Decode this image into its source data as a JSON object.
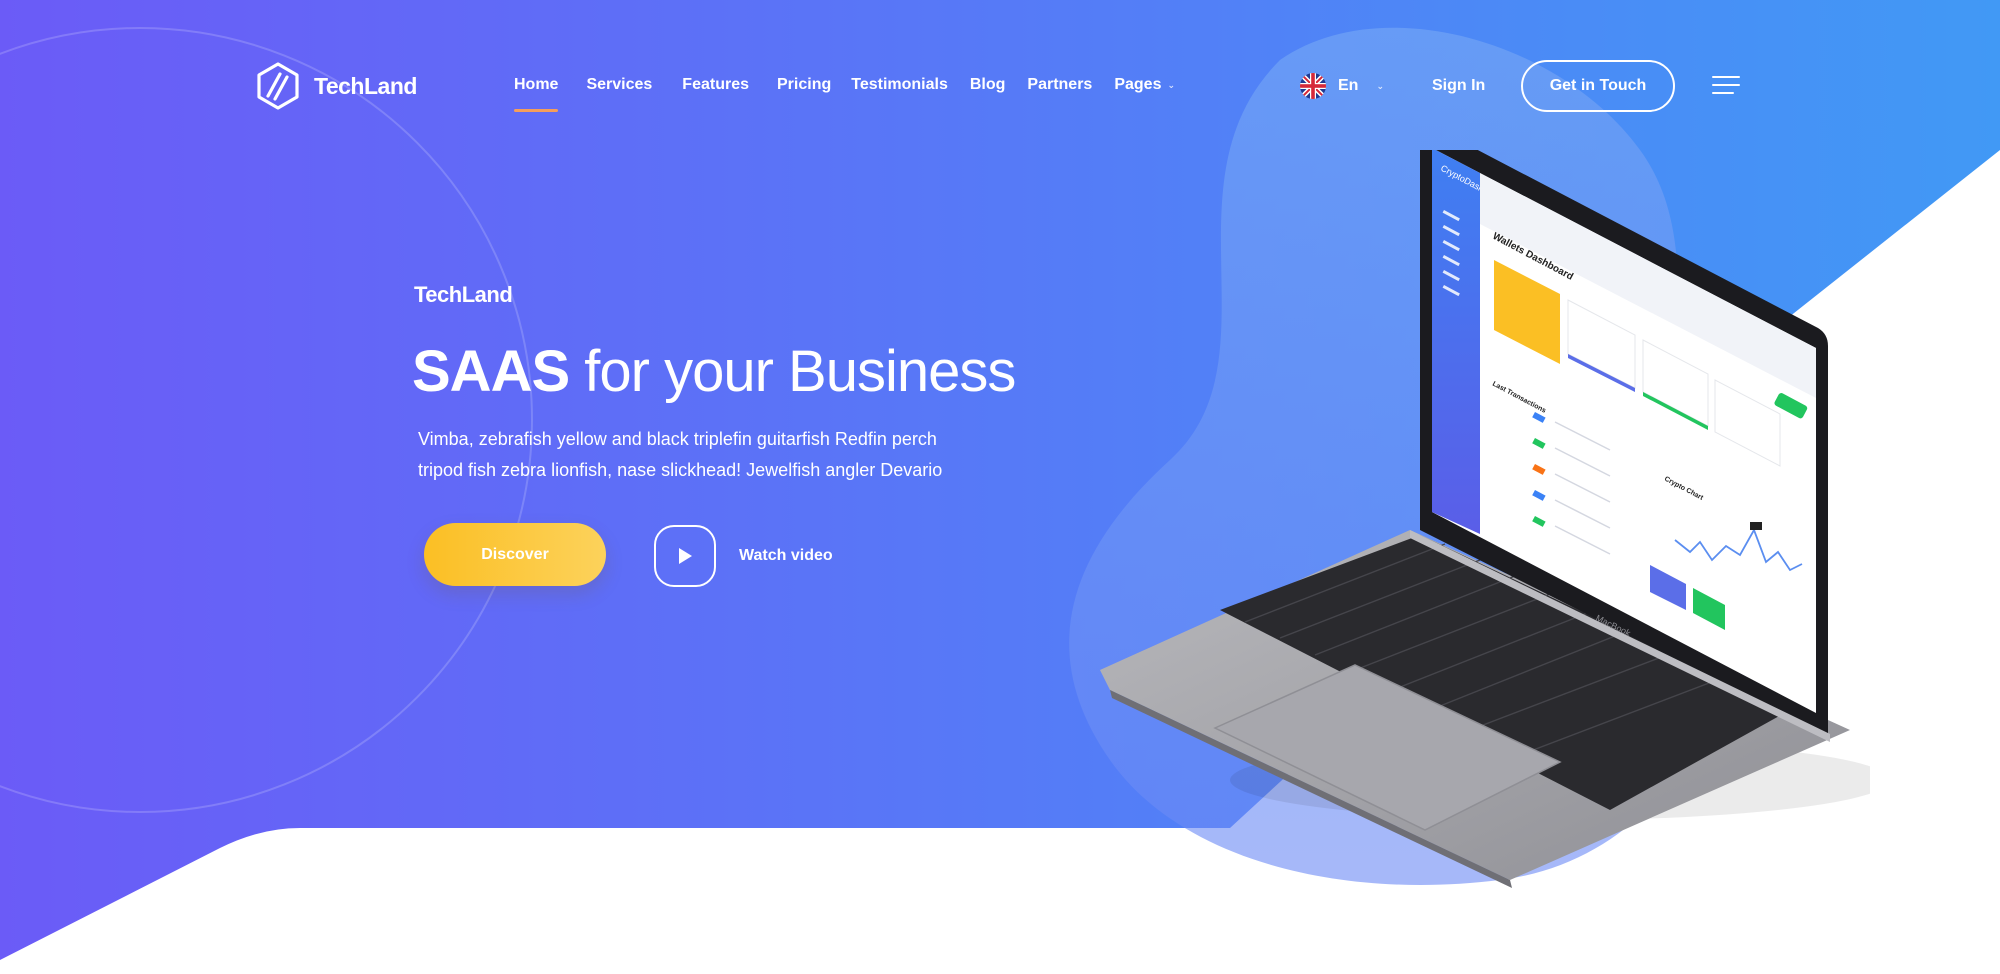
{
  "brand": {
    "name": "TechLand"
  },
  "nav": {
    "items": [
      {
        "label": "Home",
        "active": true
      },
      {
        "label": "Services"
      },
      {
        "label": "Features"
      },
      {
        "label": "Pricing"
      },
      {
        "label": "Testimonials"
      },
      {
        "label": "Blog"
      },
      {
        "label": "Partners"
      },
      {
        "label": "Pages",
        "has_dropdown": true
      }
    ]
  },
  "language": {
    "label": "En",
    "flag_icon": "uk-flag-icon"
  },
  "header": {
    "sign_in": "Sign In",
    "cta": "Get in Touch",
    "menu_icon": "hamburger-icon"
  },
  "hero": {
    "eyebrow": "TechLand",
    "headline_strong": "SAAS",
    "headline_light": "for your Business",
    "description": "Vimba, zebrafish yellow and black triplefin guitarfish Redfin perch tripod fish zebra lionfish, nase slickhead! Jewelfish angler Devario",
    "discover_label": "Discover",
    "watch_label": "Watch video"
  },
  "laptop_screen": {
    "app_name": "CryptoDash",
    "page_title": "Wallets Dashboard",
    "section_transactions": "Last Transactions",
    "section_chart": "Crypto Chart",
    "keyboard_brand": "MacBook"
  },
  "colors": {
    "gradient_start": "#6c5cf6",
    "gradient_end": "#3f9cf6",
    "accent_orange": "#f59e5b",
    "cta_yellow": "#fbbf24"
  }
}
